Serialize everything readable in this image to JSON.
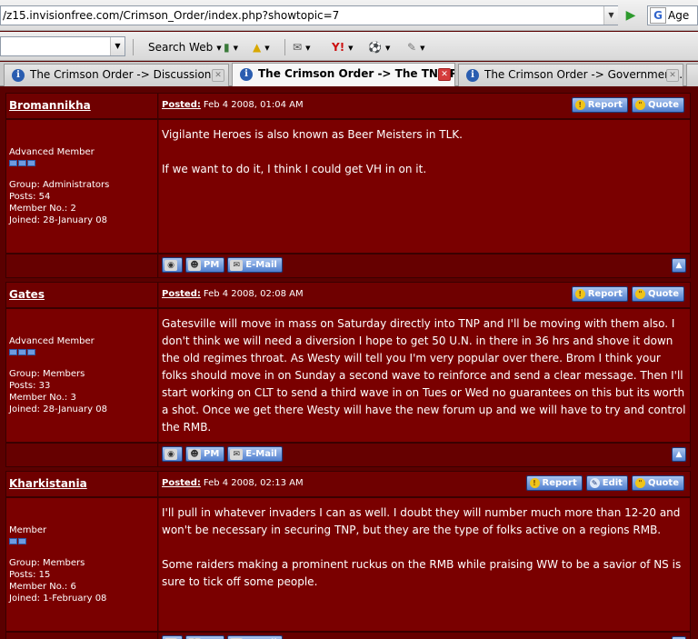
{
  "browser": {
    "address": "/z15.invisionfree.com/Crimson_Order/index.php?showtopic=7",
    "google_field": "Age",
    "search_web_label": "Search Web",
    "tabs": [
      {
        "label": "The Crimson Order -> Discussion",
        "active": false
      },
      {
        "label": "The Crimson Order -> The TNP Pl...",
        "active": true
      },
      {
        "label": "The Crimson Order -> Government...",
        "active": false
      }
    ]
  },
  "buttons": {
    "report": "Report",
    "quote": "Quote",
    "edit": "Edit",
    "pm": "PM",
    "email": "E-Mail"
  },
  "posts": [
    {
      "author": "Bromannikha",
      "posted_label": "Posted:",
      "date": "Feb 4 2008, 01:04 AM",
      "rank": "Advanced Member",
      "group": "Group: Administrators",
      "posts": "Posts: 54",
      "member_no": "Member No.: 2",
      "joined": "Joined: 28-January 08",
      "paragraphs": [
        "Vigilante Heroes is also known as Beer Meisters in TLK.",
        "If we want to do it, I think I could get VH in on it."
      ]
    },
    {
      "author": "Gates",
      "posted_label": "Posted:",
      "date": "Feb 4 2008, 02:08 AM",
      "rank": "Advanced Member",
      "group": "Group: Members",
      "posts": "Posts: 33",
      "member_no": "Member No.: 3",
      "joined": "Joined: 28-January 08",
      "paragraphs": [
        "Gatesville will move in mass on Saturday directly into TNP and I'll be moving with them also. I don't think we will need a diversion I hope to get 50 U.N. in there in 36 hrs and shove it down the old regimes throat. As Westy will tell you I'm very popular over there. Brom I think your folks should move in on Sunday a second wave to reinforce and send a clear message. Then I'll start working on CLT to send a third wave in on Tues or Wed no guarantees on this but its worth a shot. Once we get there Westy will have the new forum up and we will have to try and control the RMB."
      ]
    },
    {
      "author": "Kharkistania",
      "posted_label": "Posted:",
      "date": "Feb 4 2008, 02:13 AM",
      "rank": "Member",
      "group": "Group: Members",
      "posts": "Posts: 15",
      "member_no": "Member No.: 6",
      "joined": "Joined: 1-February 08",
      "paragraphs": [
        "I'll pull in whatever invaders I can as well. I doubt they will number much more than 12-20 and won't be necessary in securing TNP, but they are the type of folks active on a regions RMB.",
        "Some raiders making a prominent ruckus on the RMB while praising WW to be a savior of NS is sure to tick off some people."
      ]
    }
  ]
}
